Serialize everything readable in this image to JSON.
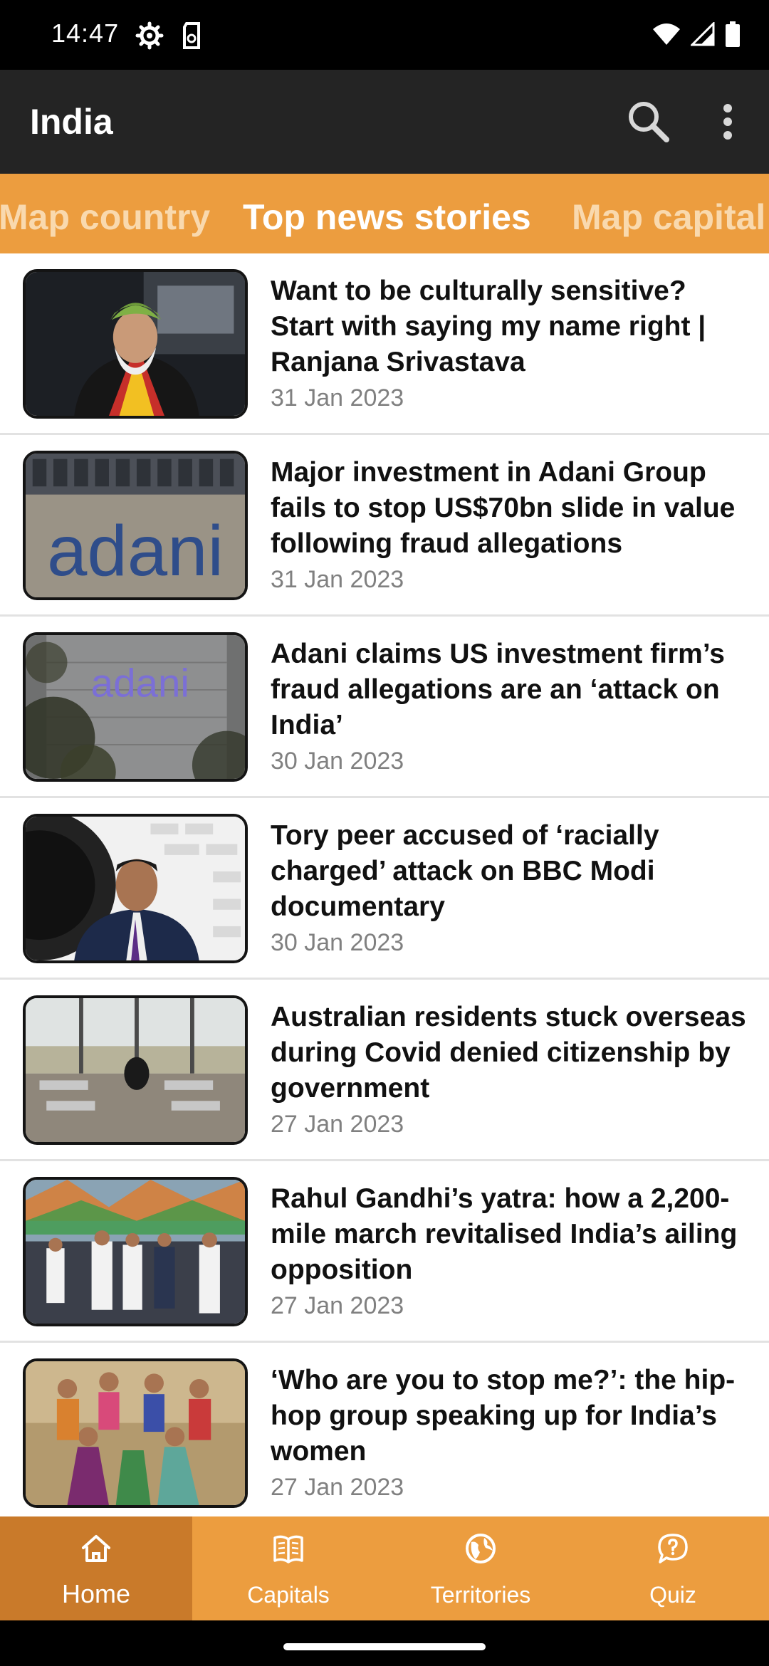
{
  "status_bar": {
    "time": "14:47",
    "icons": [
      "settings-gear-icon",
      "sd-card-icon",
      "wifi-icon",
      "cellular-signal-icon",
      "battery-icon"
    ]
  },
  "app_bar": {
    "title": "India",
    "actions": [
      "search-icon",
      "more-vert-icon"
    ]
  },
  "tabs": [
    {
      "label": "Map country",
      "active": false
    },
    {
      "label": "Top news stories",
      "active": true
    },
    {
      "label": "Map capital",
      "active": false
    }
  ],
  "news": [
    {
      "headline": "Want to be culturally sensitive? Start with saying my name right | Ranjana Srivastava",
      "date": "31 Jan 2023"
    },
    {
      "headline": "Major investment in Adani Group fails to stop US$70bn slide in value following fraud allegations",
      "date": "31 Jan 2023"
    },
    {
      "headline": "Adani claims US investment firm’s fraud allegations are an ‘attack on India’",
      "date": "30 Jan 2023"
    },
    {
      "headline": "Tory peer accused of ‘racially charged’ attack on BBC Modi documentary",
      "date": "30 Jan 2023"
    },
    {
      "headline": "Australian residents stuck overseas during Covid denied citizenship by government",
      "date": "27 Jan 2023"
    },
    {
      "headline": "Rahul Gandhi’s yatra: how a 2,200-mile march revitalised India’s ailing opposition",
      "date": "27 Jan 2023"
    },
    {
      "headline": "‘Who are you to stop me?’: the hip-hop group speaking up for India’s women",
      "date": "27 Jan 2023"
    }
  ],
  "thumb_text": {
    "adani_logo": "adani",
    "adani_logo_2": "adani"
  },
  "bottom_nav": [
    {
      "label": "Home",
      "icon": "home-icon",
      "active": true
    },
    {
      "label": "Capitals",
      "icon": "book-icon",
      "active": false
    },
    {
      "label": "Territories",
      "icon": "globe-icon",
      "active": false
    },
    {
      "label": "Quiz",
      "icon": "chat-question-icon",
      "active": false
    }
  ],
  "colors": {
    "accent": "#ec9d3f",
    "accent_dark": "#c97a2a",
    "app_bar": "#242424",
    "inactive_tab_text": "#f9d9ae"
  }
}
